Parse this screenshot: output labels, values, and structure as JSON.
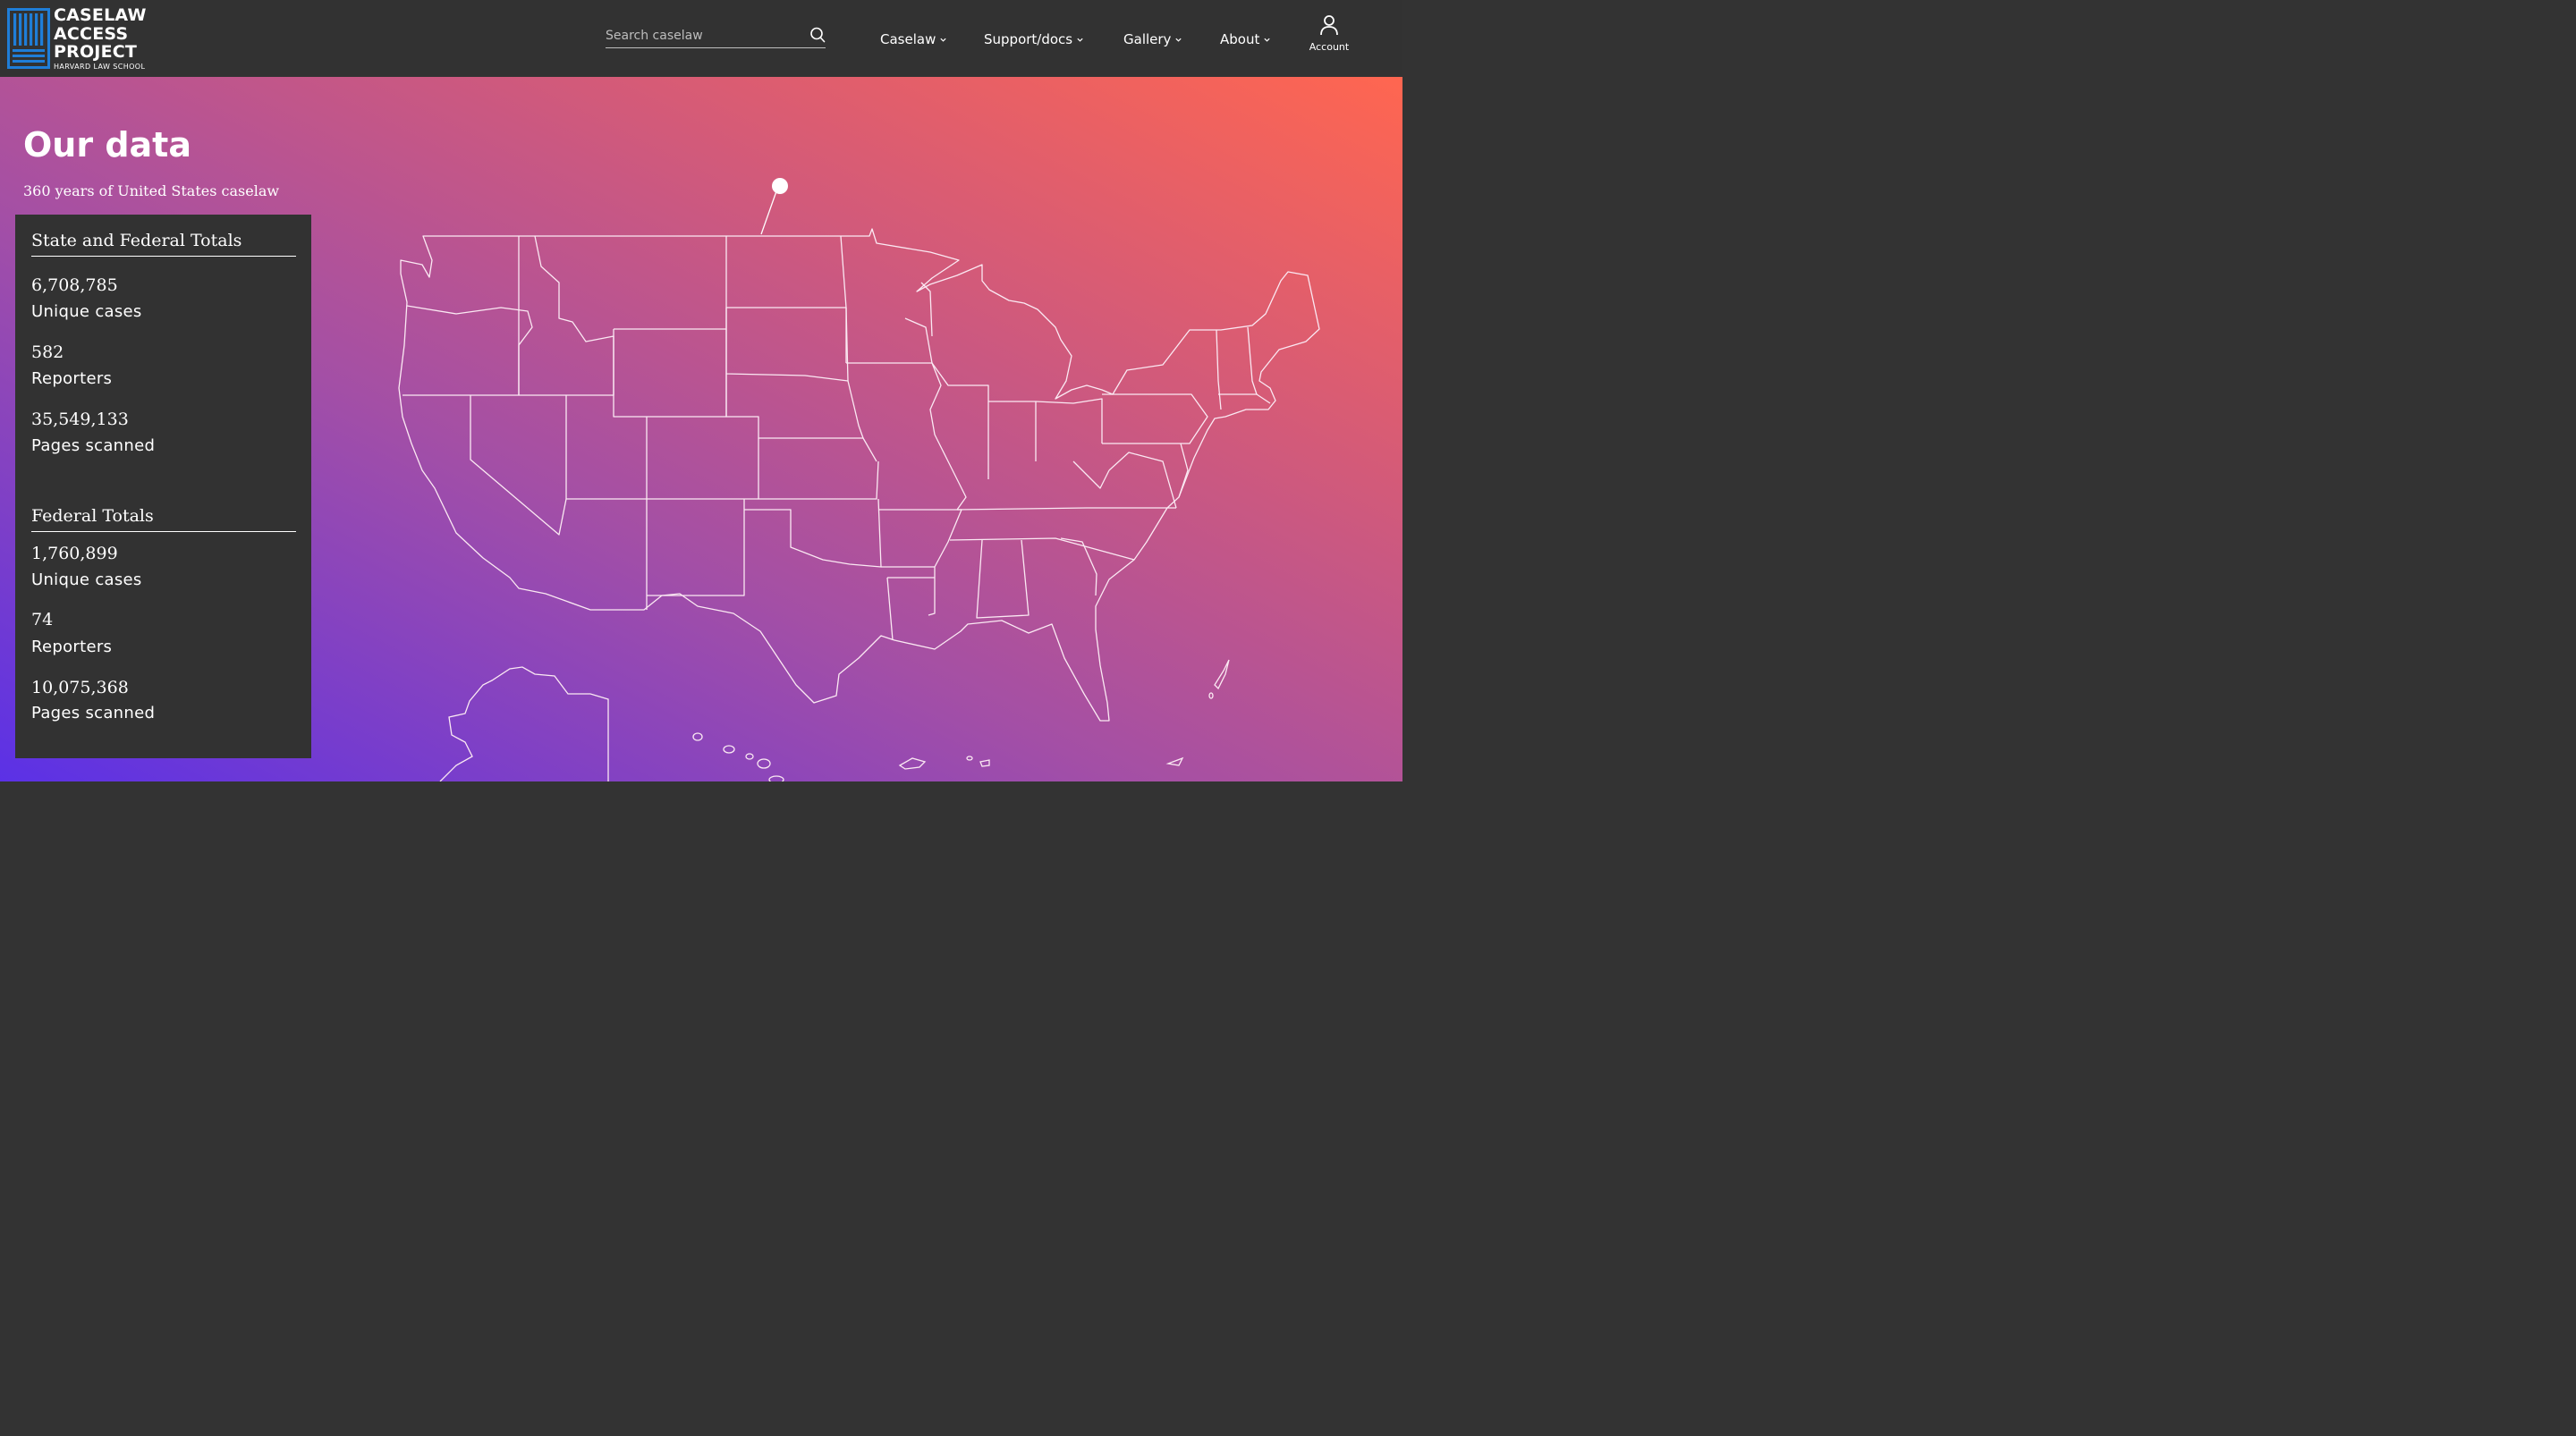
{
  "brand": {
    "lines": [
      "CASELAW",
      "ACCESS",
      "PROJECT"
    ],
    "subtitle": "HARVARD LAW SCHOOL",
    "color": "#1f7ed8"
  },
  "search": {
    "placeholder": "Search caselaw",
    "value": ""
  },
  "nav": {
    "items": [
      {
        "label": "Caselaw"
      },
      {
        "label": "Support/docs"
      },
      {
        "label": "Gallery"
      },
      {
        "label": "About"
      }
    ],
    "account_label": "Account"
  },
  "hero": {
    "title": "Our data",
    "subtitle": "360 years of United States caselaw"
  },
  "stats": {
    "state_federal": {
      "heading": "State and Federal Totals",
      "items": [
        {
          "value": "6,708,785",
          "label": "Unique cases"
        },
        {
          "value": "582",
          "label": "Reporters"
        },
        {
          "value": "35,549,133",
          "label": "Pages scanned"
        }
      ]
    },
    "federal": {
      "heading": "Federal Totals",
      "items": [
        {
          "value": "1,760,899",
          "label": "Unique cases"
        },
        {
          "value": "74",
          "label": "Reporters"
        },
        {
          "value": "10,075,368",
          "label": "Pages scanned"
        }
      ]
    }
  },
  "colors": {
    "header_bg": "#323232",
    "panel_bg": "#323232",
    "gradient_start": "#5b31e6",
    "gradient_end": "#ff6650"
  }
}
